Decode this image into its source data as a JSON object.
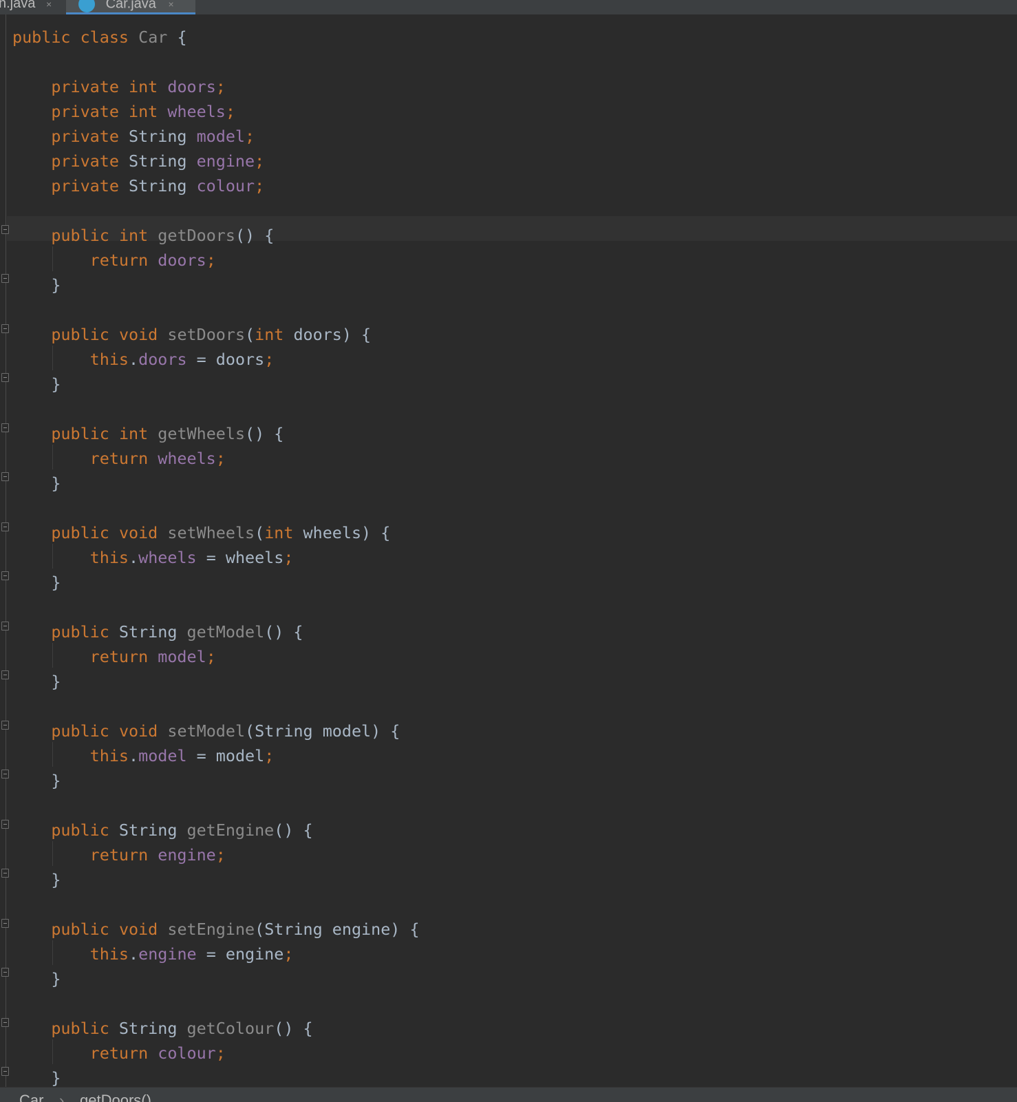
{
  "tabs": [
    {
      "label": "n.java",
      "close_icon": "×",
      "active": false
    },
    {
      "label": "Car.java",
      "close_icon": "×",
      "active": true
    }
  ],
  "code_lines": [
    [
      {
        "t": "public",
        "c": "kw"
      },
      {
        "t": " "
      },
      {
        "t": "class",
        "c": "kw"
      },
      {
        "t": " "
      },
      {
        "t": "Car",
        "c": "mth"
      },
      {
        "t": " {"
      }
    ],
    [],
    [
      {
        "t": "    "
      },
      {
        "t": "private",
        "c": "kw"
      },
      {
        "t": " "
      },
      {
        "t": "int",
        "c": "kw"
      },
      {
        "t": " "
      },
      {
        "t": "doors",
        "c": "fld"
      },
      {
        "t": ";",
        "c": "kw"
      }
    ],
    [
      {
        "t": "    "
      },
      {
        "t": "private",
        "c": "kw"
      },
      {
        "t": " "
      },
      {
        "t": "int",
        "c": "kw"
      },
      {
        "t": " "
      },
      {
        "t": "wheels",
        "c": "fld"
      },
      {
        "t": ";",
        "c": "kw"
      }
    ],
    [
      {
        "t": "    "
      },
      {
        "t": "private",
        "c": "kw"
      },
      {
        "t": " String "
      },
      {
        "t": "model",
        "c": "fld"
      },
      {
        "t": ";",
        "c": "kw"
      }
    ],
    [
      {
        "t": "    "
      },
      {
        "t": "private",
        "c": "kw"
      },
      {
        "t": " String "
      },
      {
        "t": "engine",
        "c": "fld"
      },
      {
        "t": ";",
        "c": "kw"
      }
    ],
    [
      {
        "t": "    "
      },
      {
        "t": "private",
        "c": "kw"
      },
      {
        "t": " String "
      },
      {
        "t": "colour",
        "c": "fld"
      },
      {
        "t": ";",
        "c": "kw"
      }
    ],
    [],
    [
      {
        "t": "    "
      },
      {
        "t": "public",
        "c": "kw"
      },
      {
        "t": " "
      },
      {
        "t": "int",
        "c": "kw"
      },
      {
        "t": " "
      },
      {
        "t": "getDoors",
        "c": "mth"
      },
      {
        "t": "() {"
      }
    ],
    [
      {
        "t": "        "
      },
      {
        "t": "return",
        "c": "kw"
      },
      {
        "t": " "
      },
      {
        "t": "doors",
        "c": "fld"
      },
      {
        "t": ";",
        "c": "kw"
      }
    ],
    [
      {
        "t": "    }"
      }
    ],
    [],
    [
      {
        "t": "    "
      },
      {
        "t": "public",
        "c": "kw"
      },
      {
        "t": " "
      },
      {
        "t": "void",
        "c": "kw"
      },
      {
        "t": " "
      },
      {
        "t": "setDoors",
        "c": "mth"
      },
      {
        "t": "("
      },
      {
        "t": "int",
        "c": "kw"
      },
      {
        "t": " doors) {"
      }
    ],
    [
      {
        "t": "        "
      },
      {
        "t": "this",
        "c": "kw"
      },
      {
        "t": "."
      },
      {
        "t": "doors",
        "c": "fld"
      },
      {
        "t": " = doors"
      },
      {
        "t": ";",
        "c": "kw"
      }
    ],
    [
      {
        "t": "    }"
      }
    ],
    [],
    [
      {
        "t": "    "
      },
      {
        "t": "public",
        "c": "kw"
      },
      {
        "t": " "
      },
      {
        "t": "int",
        "c": "kw"
      },
      {
        "t": " "
      },
      {
        "t": "getWheels",
        "c": "mth"
      },
      {
        "t": "() {"
      }
    ],
    [
      {
        "t": "        "
      },
      {
        "t": "return",
        "c": "kw"
      },
      {
        "t": " "
      },
      {
        "t": "wheels",
        "c": "fld"
      },
      {
        "t": ";",
        "c": "kw"
      }
    ],
    [
      {
        "t": "    }"
      }
    ],
    [],
    [
      {
        "t": "    "
      },
      {
        "t": "public",
        "c": "kw"
      },
      {
        "t": " "
      },
      {
        "t": "void",
        "c": "kw"
      },
      {
        "t": " "
      },
      {
        "t": "setWheels",
        "c": "mth"
      },
      {
        "t": "("
      },
      {
        "t": "int",
        "c": "kw"
      },
      {
        "t": " wheels) {"
      }
    ],
    [
      {
        "t": "        "
      },
      {
        "t": "this",
        "c": "kw"
      },
      {
        "t": "."
      },
      {
        "t": "wheels",
        "c": "fld"
      },
      {
        "t": " = wheels"
      },
      {
        "t": ";",
        "c": "kw"
      }
    ],
    [
      {
        "t": "    }"
      }
    ],
    [],
    [
      {
        "t": "    "
      },
      {
        "t": "public",
        "c": "kw"
      },
      {
        "t": " String "
      },
      {
        "t": "getModel",
        "c": "mth"
      },
      {
        "t": "() {"
      }
    ],
    [
      {
        "t": "        "
      },
      {
        "t": "return",
        "c": "kw"
      },
      {
        "t": " "
      },
      {
        "t": "model",
        "c": "fld"
      },
      {
        "t": ";",
        "c": "kw"
      }
    ],
    [
      {
        "t": "    }"
      }
    ],
    [],
    [
      {
        "t": "    "
      },
      {
        "t": "public",
        "c": "kw"
      },
      {
        "t": " "
      },
      {
        "t": "void",
        "c": "kw"
      },
      {
        "t": " "
      },
      {
        "t": "setModel",
        "c": "mth"
      },
      {
        "t": "(String model) {"
      }
    ],
    [
      {
        "t": "        "
      },
      {
        "t": "this",
        "c": "kw"
      },
      {
        "t": "."
      },
      {
        "t": "model",
        "c": "fld"
      },
      {
        "t": " = model"
      },
      {
        "t": ";",
        "c": "kw"
      }
    ],
    [
      {
        "t": "    }"
      }
    ],
    [],
    [
      {
        "t": "    "
      },
      {
        "t": "public",
        "c": "kw"
      },
      {
        "t": " String "
      },
      {
        "t": "getEngine",
        "c": "mth"
      },
      {
        "t": "() {"
      }
    ],
    [
      {
        "t": "        "
      },
      {
        "t": "return",
        "c": "kw"
      },
      {
        "t": " "
      },
      {
        "t": "engine",
        "c": "fld"
      },
      {
        "t": ";",
        "c": "kw"
      }
    ],
    [
      {
        "t": "    }"
      }
    ],
    [],
    [
      {
        "t": "    "
      },
      {
        "t": "public",
        "c": "kw"
      },
      {
        "t": " "
      },
      {
        "t": "void",
        "c": "kw"
      },
      {
        "t": " "
      },
      {
        "t": "setEngine",
        "c": "mth"
      },
      {
        "t": "(String engine) {"
      }
    ],
    [
      {
        "t": "        "
      },
      {
        "t": "this",
        "c": "kw"
      },
      {
        "t": "."
      },
      {
        "t": "engine",
        "c": "fld"
      },
      {
        "t": " = engine"
      },
      {
        "t": ";",
        "c": "kw"
      }
    ],
    [
      {
        "t": "    }"
      }
    ],
    [],
    [
      {
        "t": "    "
      },
      {
        "t": "public",
        "c": "kw"
      },
      {
        "t": " String "
      },
      {
        "t": "getColour",
        "c": "mth"
      },
      {
        "t": "() {"
      }
    ],
    [
      {
        "t": "        "
      },
      {
        "t": "return",
        "c": "kw"
      },
      {
        "t": " "
      },
      {
        "t": "colour",
        "c": "fld"
      },
      {
        "t": ";",
        "c": "kw"
      }
    ],
    [
      {
        "t": "    }"
      }
    ]
  ],
  "breadcrumb": {
    "items": [
      "Car",
      "getDoors()"
    ],
    "separator": "›"
  },
  "colors": {
    "keyword": "#cc7832",
    "field": "#9876aa",
    "method_declaration": "#8b8b8b",
    "default_text": "#a9b7c6",
    "editor_background": "#2b2b2b",
    "current_line": "#323232",
    "tab_accent": "#4a88c7"
  }
}
